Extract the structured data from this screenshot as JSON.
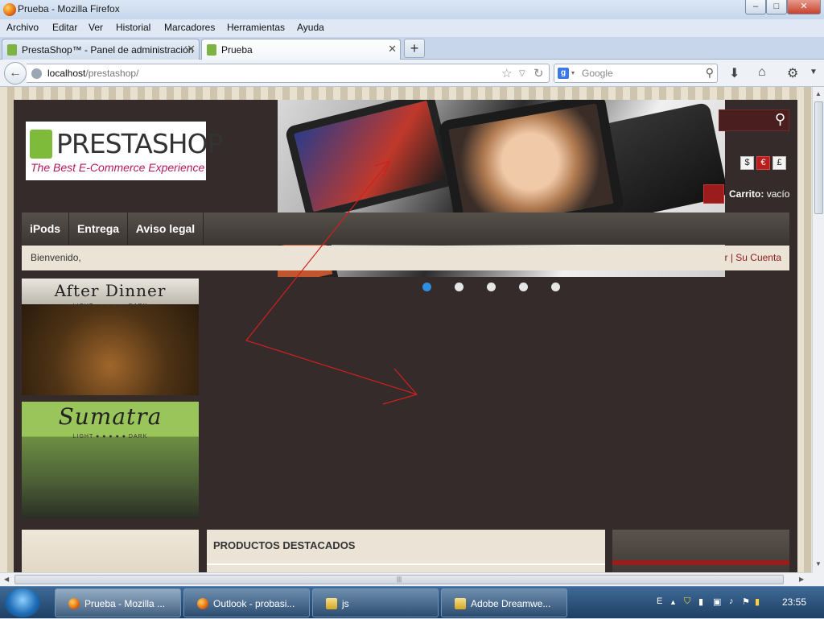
{
  "window": {
    "title": "Prueba - Mozilla Firefox",
    "controls": {
      "minimize": "–",
      "maximize": "□",
      "close": "✕"
    }
  },
  "menubar": [
    "Archivo",
    "Editar",
    "Ver",
    "Historial",
    "Marcadores",
    "Herramientas",
    "Ayuda"
  ],
  "tabs": [
    {
      "label": "PrestaShop™ - Panel de administración",
      "close": "✕"
    },
    {
      "label": "Prueba",
      "close": "✕"
    }
  ],
  "newtab": "+",
  "navbar": {
    "back": "←",
    "url_host": "localhost",
    "url_path": "/prestashop/",
    "search_engine_letter": "g",
    "search_placeholder": "Google"
  },
  "page": {
    "logo": {
      "text_presta": "PRESTA",
      "text_shop": "SHOP",
      "tagline": "The Best E-Commerce Experience"
    },
    "currencies": [
      "$",
      "€",
      "£"
    ],
    "active_currency": "€",
    "cart": {
      "label": "Carrito:",
      "status": "vacío"
    },
    "nav": [
      "iPods",
      "Entrega",
      "Aviso legal"
    ],
    "welcome": "Bienvenido,",
    "account": "r | Su Cuenta",
    "slider_dots": 5,
    "promos": [
      {
        "title": "After Dinner",
        "scale": "LIGHT ● ● ● ● ● DARK"
      },
      {
        "title": "Sumatra",
        "scale": "LIGHT ● ● ● ● ● DARK"
      }
    ],
    "featured_title": "PRODUCTOS DESTACADOS"
  },
  "taskbar": {
    "tasks": [
      "Prueba - Mozilla ...",
      "Outlook - probasi...",
      "js",
      "Adobe Dreamwe..."
    ],
    "tray_lang": "E",
    "clock": "23:55"
  }
}
